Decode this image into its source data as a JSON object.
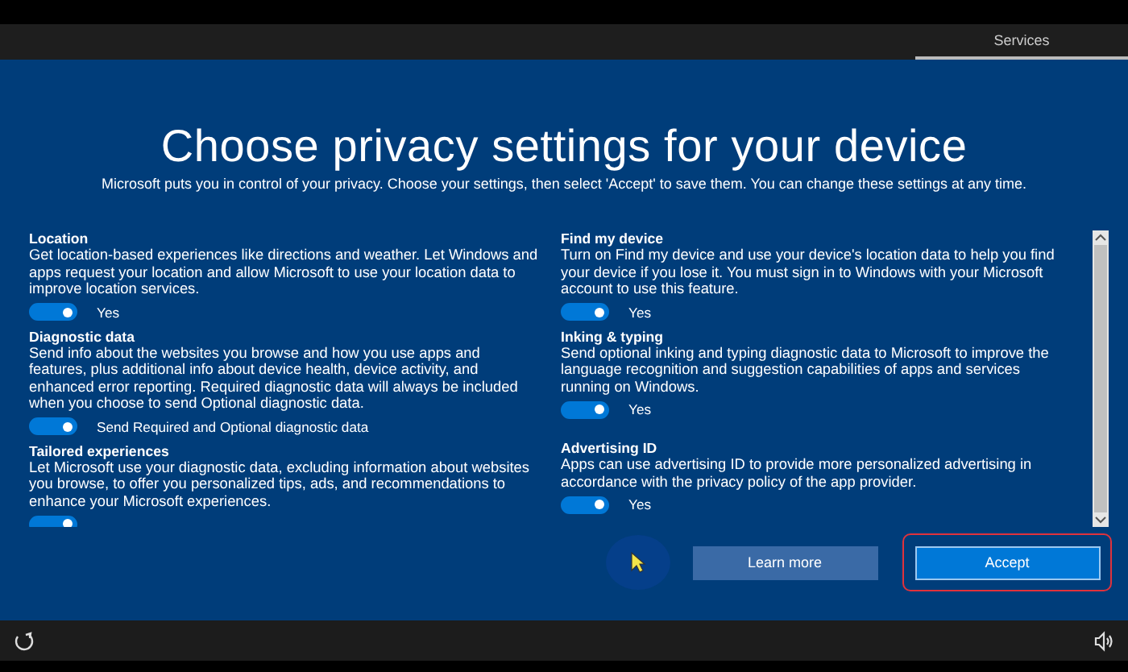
{
  "top_bar": {
    "tabs": [
      {
        "label": "Services",
        "selected": true
      }
    ]
  },
  "heading": "Choose privacy settings for your device",
  "intro": "Microsoft puts you in control of your privacy. Choose your settings, then select 'Accept' to save them. You can change these settings at any time.",
  "columns": [
    {
      "settings": [
        {
          "title": "Location",
          "description": "Get location-based experiences like directions and weather. Let Windows and apps request your location and allow Microsoft to use your location data to improve location services.",
          "on": true,
          "state_label": "Yes"
        },
        {
          "title": "Diagnostic data",
          "description": "Send info about the websites you browse and how you use apps and features, plus additional info about device health, device activity, and enhanced error reporting. Required diagnostic data will always be included when you choose to send Optional diagnostic data.",
          "on": true,
          "state_label": "Send Required and Optional diagnostic data"
        },
        {
          "title": "Tailored experiences",
          "description": "Let Microsoft use your diagnostic data, excluding information about websites you browse, to offer you personalized tips, ads, and recommendations to enhance your Microsoft experiences.",
          "on": true
        }
      ]
    },
    {
      "settings": [
        {
          "title": "Find my device",
          "description": "Turn on Find my device and use your device's location data to help you find your device if you lose it. You must sign in to Windows with your Microsoft account to use this feature.",
          "on": true,
          "state_label": "Yes"
        },
        {
          "title": "Inking & typing",
          "description": "Send optional inking and typing diagnostic data to Microsoft to improve the language recognition and suggestion capabilities of apps and services running on Windows.",
          "on": true,
          "state_label": "Yes"
        },
        {
          "title": "Advertising ID",
          "description": "Apps can use advertising ID to provide more personalized advertising in accordance with the privacy policy of the app provider.",
          "on": true,
          "state_label": "Yes"
        }
      ]
    }
  ],
  "buttons": [
    {
      "label": "Learn more",
      "kind": "secondary",
      "highlighted": false
    },
    {
      "label": "Accept",
      "kind": "primary",
      "highlighted": true
    }
  ]
}
